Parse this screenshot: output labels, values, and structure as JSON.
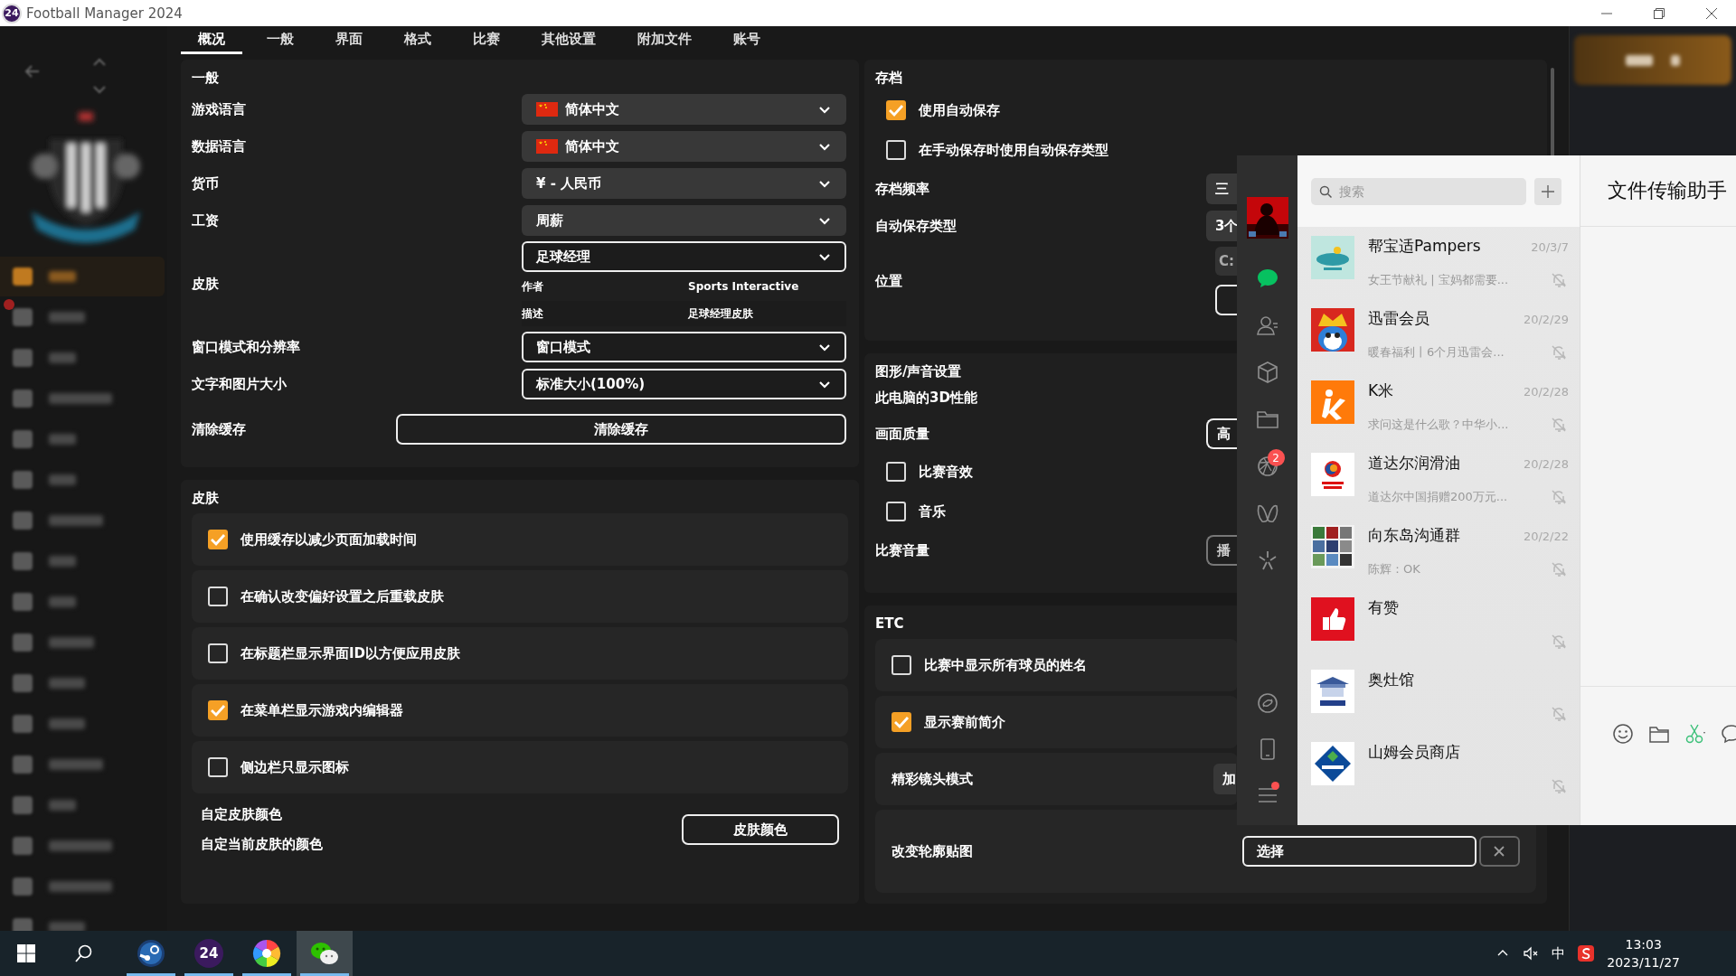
{
  "window": {
    "title": "Football Manager 2024",
    "logo_text": "24"
  },
  "sidebar": {
    "items": [
      {
        "selected": true,
        "notification": false
      },
      {
        "selected": false,
        "notification": true
      },
      {
        "selected": false,
        "notification": false
      },
      {
        "selected": false,
        "notification": false
      },
      {
        "selected": false,
        "notification": false
      },
      {
        "selected": false,
        "notification": false
      },
      {
        "selected": false,
        "notification": false
      },
      {
        "selected": false,
        "notification": false
      },
      {
        "selected": false,
        "notification": false
      },
      {
        "selected": false,
        "notification": false
      },
      {
        "selected": false,
        "notification": false
      },
      {
        "selected": false,
        "notification": false
      },
      {
        "selected": false,
        "notification": false
      },
      {
        "selected": false,
        "notification": false
      },
      {
        "selected": false,
        "notification": false
      },
      {
        "selected": false,
        "notification": false
      },
      {
        "selected": false,
        "notification": false
      }
    ]
  },
  "tabs": [
    {
      "label": "概况",
      "selected": true
    },
    {
      "label": "一般",
      "selected": false
    },
    {
      "label": "界面",
      "selected": false
    },
    {
      "label": "格式",
      "selected": false
    },
    {
      "label": "比赛",
      "selected": false
    },
    {
      "label": "其他设置",
      "selected": false
    },
    {
      "label": "附加文件",
      "selected": false
    },
    {
      "label": "账号",
      "selected": false
    }
  ],
  "general": {
    "title": "一般",
    "rows": [
      {
        "kind": "dropdown",
        "label": "游戏语言",
        "value": "简体中文",
        "flag": true
      },
      {
        "kind": "dropdown",
        "label": "数据语言",
        "value": "简体中文",
        "flag": true
      },
      {
        "kind": "dropdown",
        "label": "货币",
        "value": "¥ - 人民币",
        "flag": false
      },
      {
        "kind": "dropdown",
        "label": "工资",
        "value": "周薪",
        "flag": false
      },
      {
        "kind": "skin",
        "label": "皮肤",
        "value": "足球经理",
        "flag": false,
        "details": [
          {
            "key": "作者",
            "value": "Sports Interactive"
          },
          {
            "key": "描述",
            "value": "足球经理皮肤"
          }
        ]
      },
      {
        "kind": "outlined_dropdown",
        "label": "窗口模式和分辨率",
        "value": "窗口模式",
        "flag": false
      },
      {
        "kind": "outlined_dropdown",
        "label": "文字和图片大小",
        "value": "标准大小(100%)",
        "flag": false
      },
      {
        "kind": "button",
        "label": "清除缓存",
        "value": "清除缓存"
      }
    ]
  },
  "skin": {
    "title": "皮肤",
    "options": [
      {
        "label": "使用缓存以减少页面加载时间",
        "checked": true
      },
      {
        "label": "在确认改变偏好设置之后重载皮肤",
        "checked": false
      },
      {
        "label": "在标题栏显示界面ID以方便应用皮肤",
        "checked": false
      },
      {
        "label": "在菜单栏显示游戏内编辑器",
        "checked": true
      },
      {
        "label": "侧边栏只显示图标",
        "checked": false
      }
    ],
    "custom_color": {
      "title": "自定皮肤颜色",
      "description": "自定当前皮肤的颜色",
      "button": "皮肤颜色"
    }
  },
  "saves": {
    "title": "存档",
    "items": [
      {
        "kind": "checkbox",
        "label": "使用自动保存",
        "checked": true
      },
      {
        "kind": "checkbox",
        "label": "在手动保存时使用自动保存类型",
        "checked": false
      },
      {
        "kind": "dropdown",
        "label": "存档频率",
        "value": "三"
      },
      {
        "kind": "dropdown",
        "label": "自动保存类型",
        "value": "3个"
      },
      {
        "kind": "path",
        "label": "位置",
        "value": "C:"
      }
    ]
  },
  "graphics": {
    "title": "图形/声音设置",
    "items": [
      {
        "kind": "text",
        "label": "此电脑的3D性能"
      },
      {
        "kind": "button",
        "label": "画面质量",
        "value": "高",
        "disabled": false
      },
      {
        "kind": "checkbox",
        "label": "比赛音效",
        "checked": false
      },
      {
        "kind": "checkbox",
        "label": "音乐",
        "checked": false
      },
      {
        "kind": "button",
        "label": "比赛音量",
        "value": "播",
        "disabled": true
      }
    ]
  },
  "etc": {
    "title": "ETC",
    "items": [
      {
        "kind": "checkbox",
        "label": "比赛中显示所有球员的姓名",
        "checked": false
      },
      {
        "kind": "checkbox",
        "label": "显示赛前简介",
        "checked": true
      },
      {
        "kind": "dropdown",
        "label": "精彩镜头模式",
        "value": "加"
      },
      {
        "kind": "file",
        "label": "改变轮廓贴图",
        "value": "选择"
      }
    ]
  },
  "wechat": {
    "nav_top": [
      {
        "kind": "chats",
        "selected": true
      },
      {
        "kind": "contacts",
        "selected": false
      },
      {
        "kind": "cube",
        "selected": false
      },
      {
        "kind": "folder",
        "selected": false
      },
      {
        "kind": "aperture",
        "selected": false,
        "badge": "2"
      },
      {
        "kind": "butterfly",
        "selected": false
      },
      {
        "kind": "sparkle",
        "selected": false
      }
    ],
    "nav_bottom": [
      {
        "kind": "link",
        "dot": false
      },
      {
        "kind": "phone",
        "dot": false
      },
      {
        "kind": "menu",
        "dot": true
      }
    ],
    "search": {
      "placeholder": "搜索"
    },
    "chats": [
      {
        "name": "帮宝适Pampers",
        "time": "20/3/7",
        "preview": "女王节献礼 | 宝妈都需要...",
        "muted": true
      },
      {
        "name": "迅雷会员",
        "time": "20/2/29",
        "preview": "暖春福利丨6个月迅雷会...",
        "muted": true
      },
      {
        "name": "K米",
        "time": "20/2/28",
        "preview": "求问这是什么歌？中华小...",
        "muted": true
      },
      {
        "name": "道达尔润滑油",
        "time": "20/2/28",
        "preview": "道达尔中国捐赠200万元...",
        "muted": true
      },
      {
        "name": "向东岛沟通群",
        "time": "20/2/22",
        "preview": "陈辉：OK",
        "muted": true
      },
      {
        "name": "有赞",
        "muted": true
      },
      {
        "name": "奥灶馆",
        "muted": true
      },
      {
        "name": "山姆会员商店",
        "muted": true
      }
    ],
    "title": "文件传输助手"
  },
  "taskbar": {
    "apps": [
      {
        "kind": "steam",
        "running": true,
        "active": false
      },
      {
        "kind": "fm",
        "label": "24",
        "running": true,
        "active": false
      },
      {
        "kind": "pinwheel",
        "running": true,
        "active": false
      },
      {
        "kind": "wechat",
        "running": true,
        "active": true
      }
    ],
    "ime": "中",
    "time": "13:03",
    "date": "2023/11/27"
  }
}
